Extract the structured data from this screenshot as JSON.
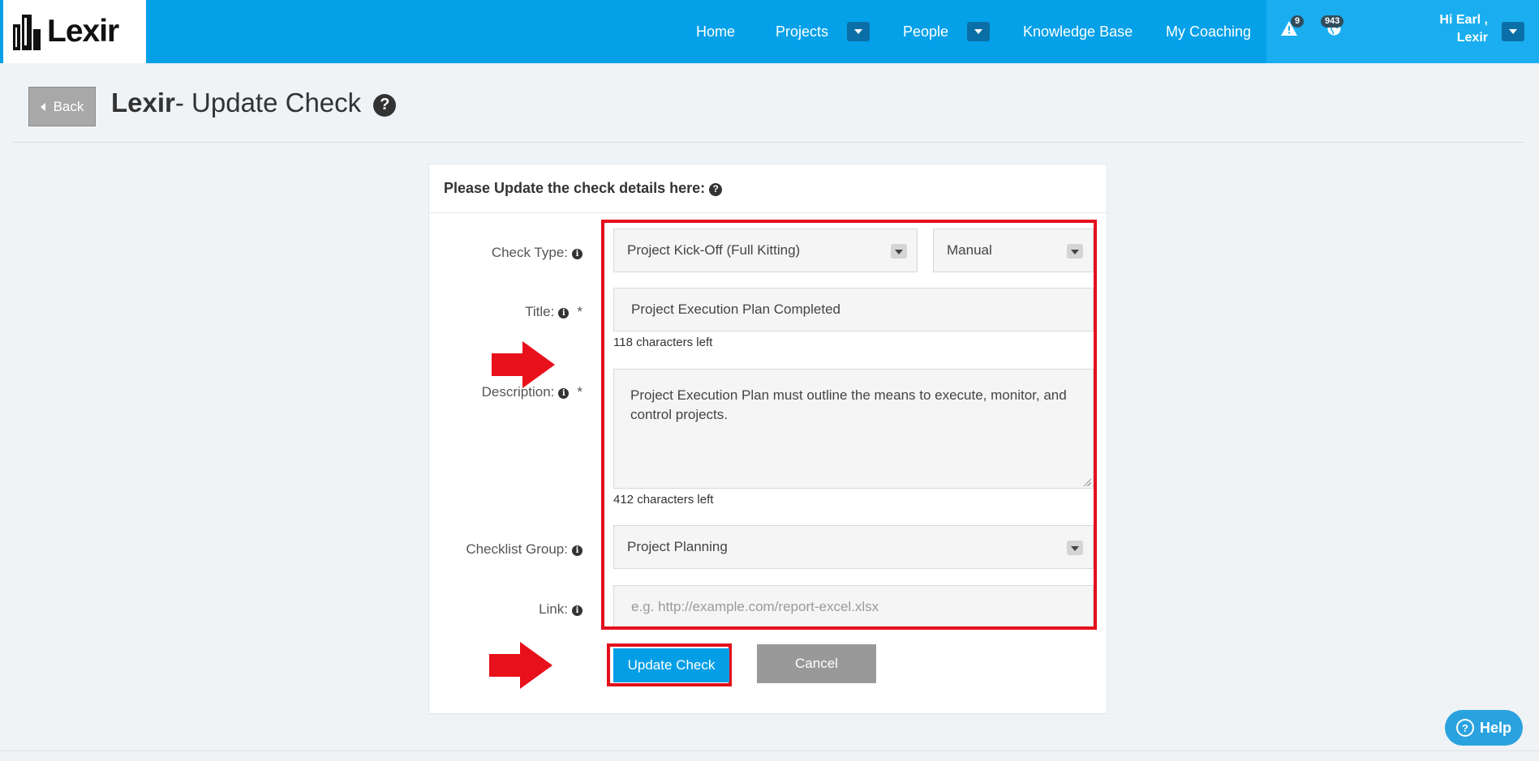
{
  "nav": {
    "brand": "Lexir",
    "items": [
      {
        "label": "Home"
      },
      {
        "label": "Projects"
      },
      {
        "label": "People"
      },
      {
        "label": "Knowledge Base"
      },
      {
        "label": "My Coaching"
      }
    ],
    "alerts_count": "9",
    "globe_count": "943",
    "user_line1": "Hi Earl ,",
    "user_line2": "Lexir"
  },
  "header": {
    "back_label": "Back",
    "title_brand": "Lexir",
    "title_rest": "- Update Check"
  },
  "card": {
    "heading": "Please Update the check details here:"
  },
  "form": {
    "check_type_label": "Check Type:",
    "check_type_value": "Project Kick-Off (Full Kitting)",
    "check_mode_value": "Manual",
    "title_label": "Title:",
    "title_value": "Project Execution Plan Completed",
    "title_chars_left": "118 characters left",
    "description_label": "Description:",
    "description_value": "Project Execution Plan must outline the means to execute, monitor, and control projects.",
    "description_chars_left": "412 characters left",
    "checklist_group_label": "Checklist Group:",
    "checklist_group_value": "Project Planning",
    "link_label": "Link:",
    "link_placeholder": "e.g. http://example.com/report-excel.xlsx",
    "required_mark": "*"
  },
  "actions": {
    "update_label": "Update Check",
    "cancel_label": "Cancel"
  },
  "help_label": "Help",
  "colors": {
    "nav_blue": "#04a0e8",
    "annotation_red": "#e3101c",
    "primary_button": "#049ee6",
    "cancel_button": "#999999"
  }
}
